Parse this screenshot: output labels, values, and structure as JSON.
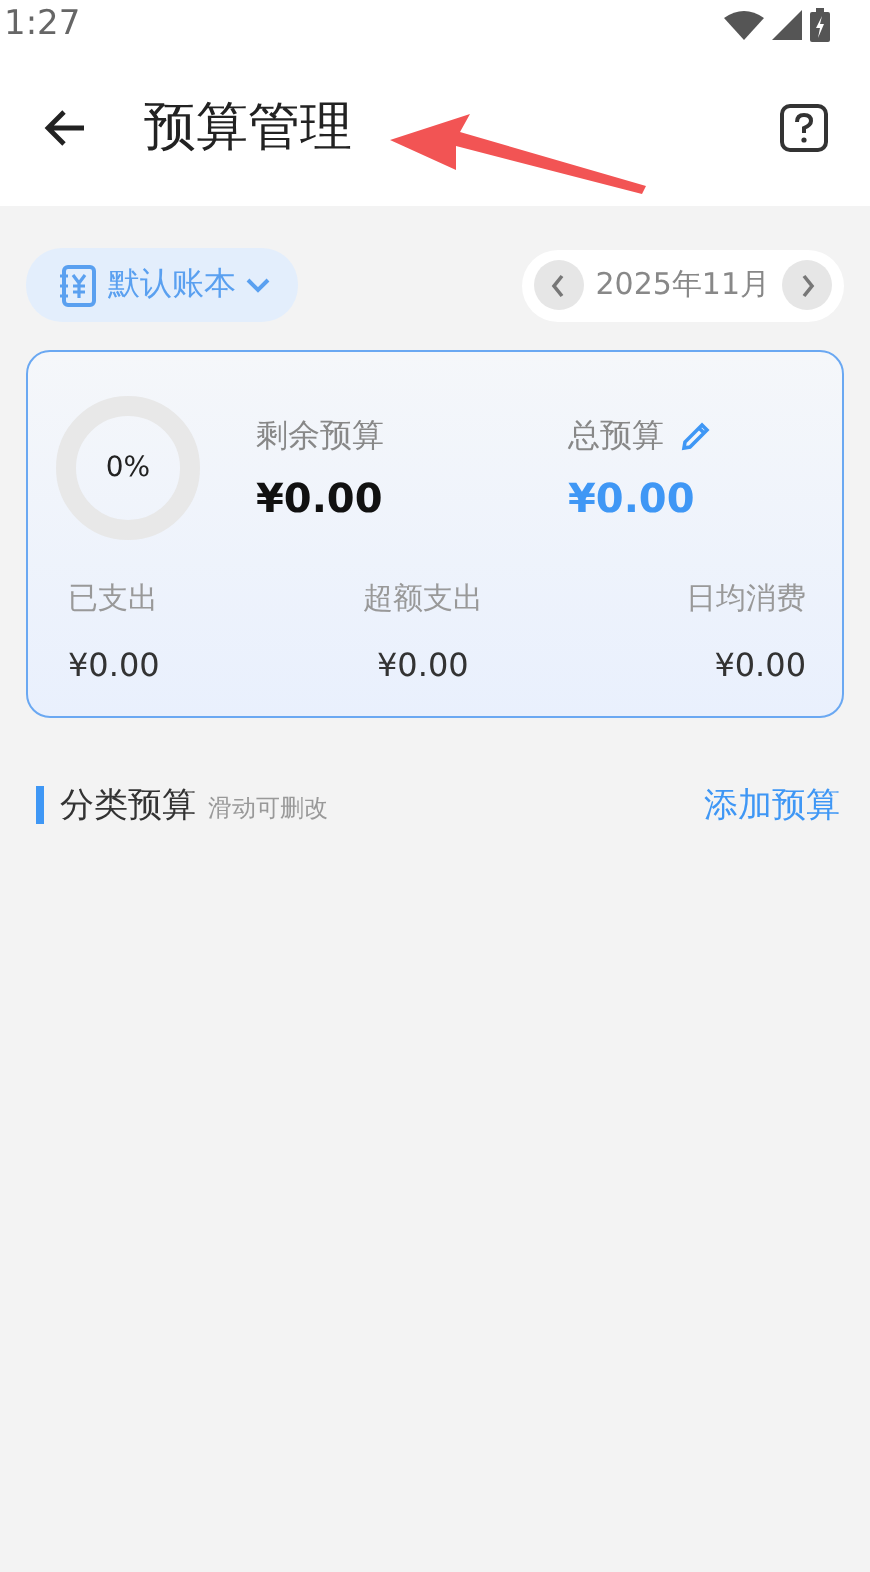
{
  "status_bar": {
    "time": "1:27"
  },
  "header": {
    "title": "预算管理"
  },
  "annotation": {
    "kind": "arrow",
    "color": "#f25454"
  },
  "account": {
    "label": "默认账本"
  },
  "month": {
    "label": "2025年11月"
  },
  "summary": {
    "progress": {
      "level": 0,
      "label": "0%"
    },
    "remaining": {
      "label": "剩余预算",
      "value": "¥0.00"
    },
    "total": {
      "label": "总预算",
      "value": "¥0.00"
    },
    "stats": [
      {
        "label": "已支出",
        "value": "¥0.00"
      },
      {
        "label": "超额支出",
        "value": "¥0.00"
      },
      {
        "label": "日均消费",
        "value": "¥0.00"
      }
    ]
  },
  "category_section": {
    "title": "分类预算",
    "hint": "滑动可删改",
    "action": "添加预算"
  }
}
